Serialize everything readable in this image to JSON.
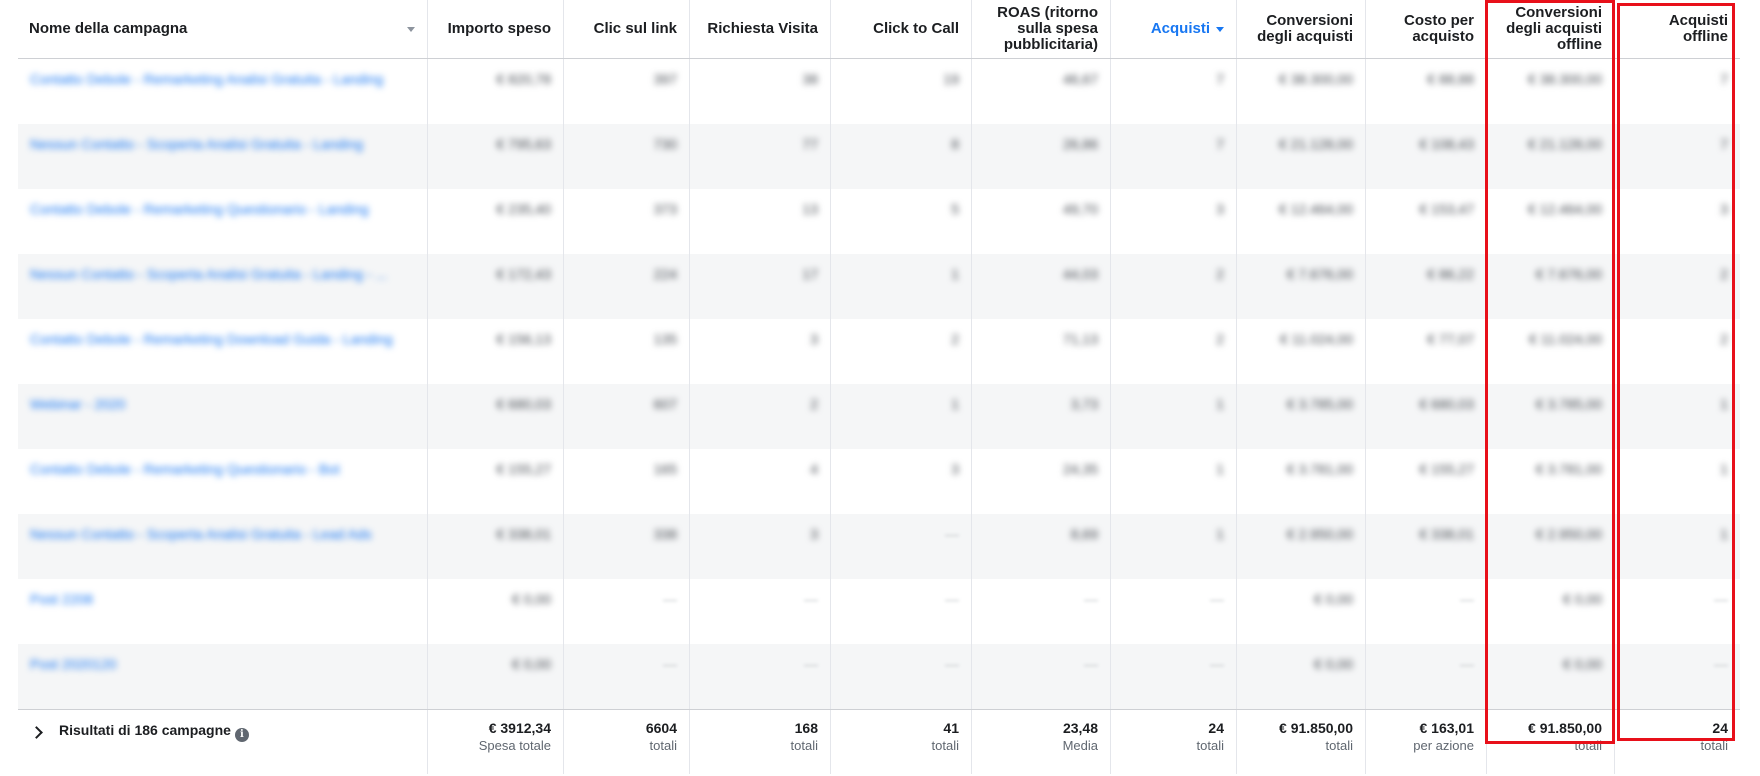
{
  "columns": [
    {
      "key": "campaign",
      "label": "Nome della campagna",
      "sorted": false
    },
    {
      "key": "spend",
      "label": "Importo speso",
      "sorted": false
    },
    {
      "key": "clicks",
      "label": "Clic sul link",
      "sorted": false
    },
    {
      "key": "visit",
      "label": "Richiesta Visita",
      "sorted": false
    },
    {
      "key": "call",
      "label": "Click to Call",
      "sorted": false
    },
    {
      "key": "roas",
      "label": "ROAS (ritorno sulla spesa pubblicitaria)",
      "sorted": false
    },
    {
      "key": "purchases",
      "label": "Acquisti",
      "sorted": true
    },
    {
      "key": "conv",
      "label": "Conversioni degli acquisti",
      "sorted": false
    },
    {
      "key": "cpa",
      "label": "Costo per acquisto",
      "sorted": false
    },
    {
      "key": "conv_off",
      "label": "Conversioni degli acquisti offline",
      "sorted": false
    },
    {
      "key": "purch_off",
      "label": "Acquisti offline",
      "sorted": false
    }
  ],
  "rows": [
    [
      "Contatto Debole - Remarketing Analisi Gratuita - Landing",
      "€ 820,78",
      "397",
      "38",
      "19",
      "46,67",
      "7",
      "€ 38.300,00",
      "€ 88,88",
      "€ 38.300,00",
      "7"
    ],
    [
      "Nessun Contatto - Scoperta Analisi Gratuita - Landing",
      "€ 795,63",
      "730",
      "77",
      "8",
      "26,86",
      "7",
      "€ 21.128,00",
      "€ 108,43",
      "€ 21.128,00",
      "7"
    ],
    [
      "Contatto Debole - Remarketing Questionario - Landing",
      "€ 235,40",
      "373",
      "13",
      "5",
      "49,70",
      "3",
      "€ 12.464,00",
      "€ 153,47",
      "€ 12.464,00",
      "3"
    ],
    [
      "Nessun Contatto - Scoperta Analisi Gratuita - Landing - ...",
      "€ 172,43",
      "224",
      "17",
      "1",
      "44,03",
      "2",
      "€ 7.676,00",
      "€ 86,22",
      "€ 7.676,00",
      "2"
    ],
    [
      "Contatto Debole - Remarketing Download Guida - Landing",
      "€ 156,13",
      "135",
      "3",
      "2",
      "71,13",
      "2",
      "€ 11.024,00",
      "€ 77,07",
      "€ 11.024,00",
      "2"
    ],
    [
      "Webinar - 2020",
      "€ 680,03",
      "607",
      "2",
      "1",
      "3,73",
      "1",
      "€ 3.785,00",
      "€ 680,03",
      "€ 3.785,00",
      "1"
    ],
    [
      "Contatto Debole - Remarketing Questionario - Bot",
      "€ 155,27",
      "165",
      "4",
      "3",
      "24,35",
      "1",
      "€ 3.781,00",
      "€ 155,27",
      "€ 3.781,00",
      "1"
    ],
    [
      "Nessun Contatto - Scoperta Analisi Gratuita - Lead Ads",
      "€ 338,01",
      "338",
      "3",
      "—",
      "8,69",
      "1",
      "€ 2.950,00",
      "€ 338,01",
      "€ 2.950,00",
      "1"
    ],
    [
      "Post 2208",
      "€ 0,00",
      "—",
      "—",
      "—",
      "—",
      "—",
      "€ 0,00",
      "—",
      "€ 0,00",
      "—"
    ],
    [
      "Post 2020120",
      "€ 0,00",
      "—",
      "—",
      "—",
      "—",
      "—",
      "€ 0,00",
      "—",
      "€ 0,00",
      "—"
    ]
  ],
  "footer": {
    "title": "Risultati di 186 campagne",
    "info_icon": "i",
    "cells": [
      {
        "value": "€ 3912,34",
        "sub": "Spesa totale"
      },
      {
        "value": "6604",
        "sub": "totali"
      },
      {
        "value": "168",
        "sub": "totali"
      },
      {
        "value": "41",
        "sub": "totali"
      },
      {
        "value": "23,48",
        "sub": "Media"
      },
      {
        "value": "24",
        "sub": "totali"
      },
      {
        "value": "€ 91.850,00",
        "sub": "totali"
      },
      {
        "value": "€ 163,01",
        "sub": "per azione"
      },
      {
        "value": "€ 91.850,00",
        "sub": "totali"
      },
      {
        "value": "24",
        "sub": "totali"
      }
    ]
  },
  "colors": {
    "accent": "#1877f2",
    "highlight": "#e8101a"
  }
}
